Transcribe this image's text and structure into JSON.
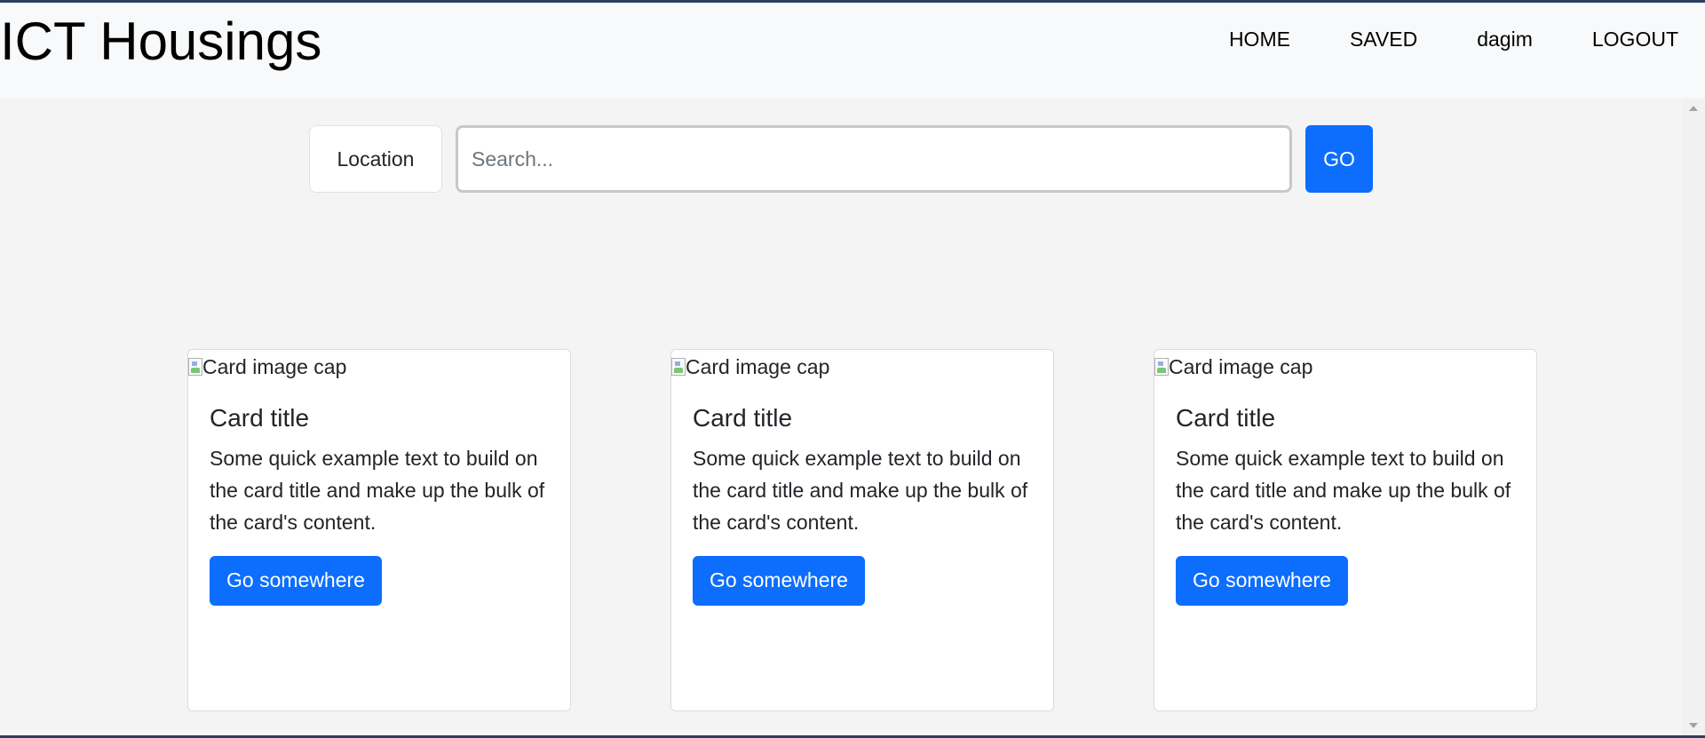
{
  "navbar": {
    "brand": "ICT Housings",
    "links": [
      {
        "label": "HOME"
      },
      {
        "label": "SAVED"
      },
      {
        "label": "dagim"
      },
      {
        "label": "LOGOUT"
      }
    ]
  },
  "search": {
    "location_label": "Location",
    "placeholder": "Search...",
    "go_label": "GO"
  },
  "cards": [
    {
      "image_alt": "Card image cap",
      "title": "Card title",
      "text": "Some quick example text to build on the card title and make up the bulk of the card's content.",
      "button": "Go somewhere"
    },
    {
      "image_alt": "Card image cap",
      "title": "Card title",
      "text": "Some quick example text to build on the card title and make up the bulk of the card's content.",
      "button": "Go somewhere"
    },
    {
      "image_alt": "Card image cap",
      "title": "Card title",
      "text": "Some quick example text to build on the card title and make up the bulk of the card's content.",
      "button": "Go somewhere"
    }
  ],
  "colors": {
    "primary": "#0d6efd",
    "navbar_bg": "#f8f9fa",
    "page_bg": "#f4f4f4"
  },
  "icons": [
    "broken-image-icon",
    "scroll-up-icon",
    "scroll-down-icon"
  ]
}
